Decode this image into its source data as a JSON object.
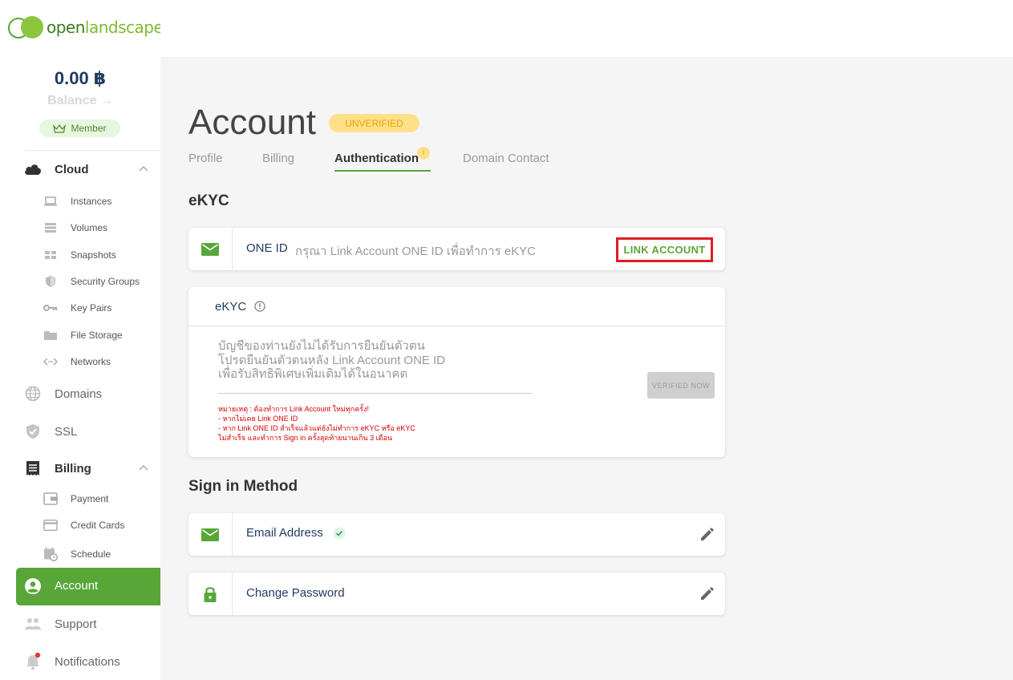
{
  "brand": {
    "logo_text_a": "open",
    "logo_text_b": "landscape"
  },
  "sidebar": {
    "balance_amount": "0.00 ฿",
    "balance_label": "Balance →",
    "member_label": "Member",
    "cloud": {
      "label": "Cloud",
      "items": [
        "Instances",
        "Volumes",
        "Snapshots",
        "Security Groups",
        "Key Pairs",
        "File Storage",
        "Networks"
      ]
    },
    "domains": "Domains",
    "ssl": "SSL",
    "billing": {
      "label": "Billing",
      "items": [
        "Payment",
        "Credit Cards",
        "Schedule"
      ]
    },
    "account": "Account",
    "support": "Support",
    "notifications": "Notifications"
  },
  "page": {
    "title": "Account",
    "status_badge": "UNVERIFIED",
    "tabs": [
      "Profile",
      "Billing",
      "Authentication",
      "Domain Contact"
    ],
    "active_tab": "Authentication",
    "tab_info": "i"
  },
  "ekyc_section": {
    "heading": "eKYC",
    "one_id": {
      "title": "ONE ID",
      "description": "กรุณา Link Account ONE ID เพื่อทำการ eKYC",
      "button": "LINK ACCOUNT"
    },
    "card": {
      "title": "eKYC",
      "lines": [
        "บัญชีของท่านยังไม่ได้รับการยืนยันตัวตน",
        "โปรดยืนยันตัวตนหลัง Link Account ONE ID",
        "เพื่อรับสิทธิพิเศษเพิ่มเติมได้ในอนาคต"
      ],
      "notes": [
        "หมายเหตุ : ต้องทำการ Link Account ใหม่ทุกครั้ง!",
        "- หากไม่เคย Link ONE ID",
        "- หาก Link ONE ID สำเร็จแล้วแต่ยังไม่ทำการ eKYC หรือ eKYC",
        "ไม่สำเร็จ และทำการ Sign in ครั้งสุดท้ายนานเกิน 3 เดือน"
      ],
      "button": "VERIFIED NOW"
    }
  },
  "signin_section": {
    "heading": "Sign in Method",
    "email": "Email Address",
    "password": "Change Password"
  },
  "colors": {
    "accent": "#58a638",
    "navy": "#1e3a5f",
    "warning": "#ffe08a",
    "highlight": "#e01b24"
  }
}
